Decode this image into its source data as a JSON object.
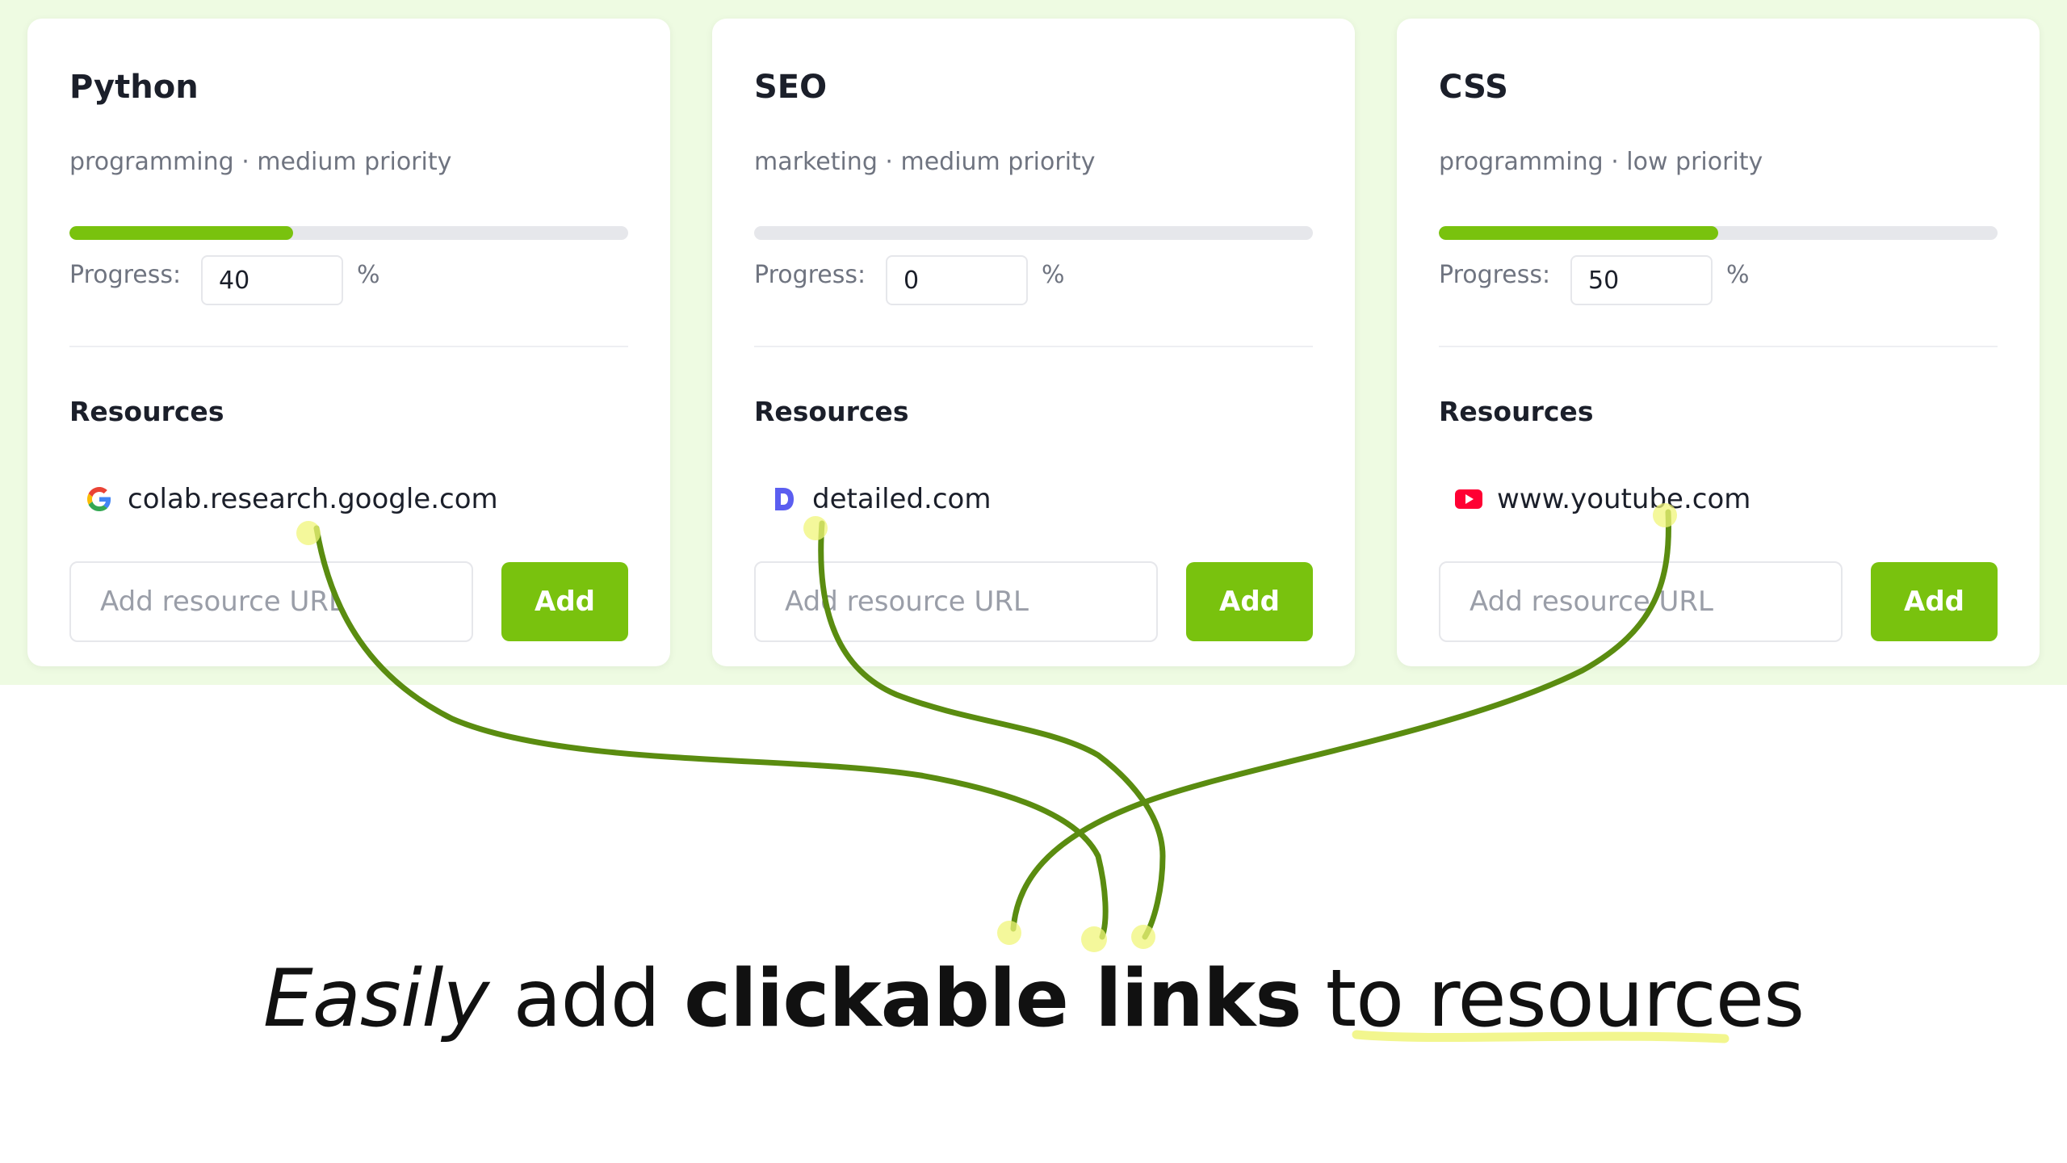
{
  "cards": [
    {
      "title": "Python",
      "meta": "programming · medium priority",
      "progress": 40,
      "progress_label": "Progress:",
      "progress_value": "40",
      "pct_symbol": "%",
      "resources_heading": "Resources",
      "resource": {
        "icon": "google-icon",
        "label": "colab.research.google.com"
      },
      "url_placeholder": "Add resource URL",
      "add_label": "Add"
    },
    {
      "title": "SEO",
      "meta": "marketing · medium priority",
      "progress": 0,
      "progress_label": "Progress:",
      "progress_value": "0",
      "pct_symbol": "%",
      "resources_heading": "Resources",
      "resource": {
        "icon": "detailed-d-icon",
        "label": "detailed.com"
      },
      "url_placeholder": "Add resource URL",
      "add_label": "Add"
    },
    {
      "title": "CSS",
      "meta": "programming · low priority",
      "progress": 50,
      "progress_label": "Progress:",
      "progress_value": "50",
      "pct_symbol": "%",
      "resources_heading": "Resources",
      "resource": {
        "icon": "youtube-icon",
        "label": "www.youtube.com"
      },
      "url_placeholder": "Add resource URL",
      "add_label": "Add"
    }
  ],
  "tagline": {
    "part1": "Easily",
    "part2": " add ",
    "part3": "clickable links",
    "part4": " to ",
    "part5": "resources"
  },
  "colors": {
    "accent": "#79c20e",
    "band": "#eefbe2",
    "arrow": "#5a8c10",
    "highlight": "#f0f57a"
  }
}
